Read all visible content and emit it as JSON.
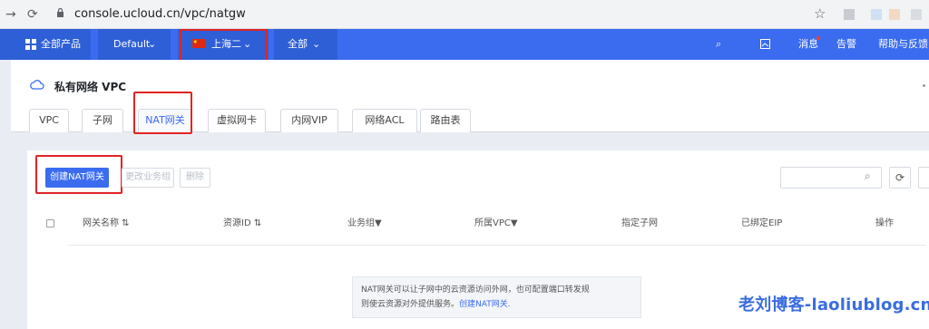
{
  "browser": {
    "url": "console.ucloud.cn/vpc/natgw"
  },
  "topnav": {
    "all_products": "全部产品",
    "project": "Default",
    "region": "上海二",
    "scope": "全部",
    "messages": "消息",
    "alerts": "告警",
    "help": "帮助与反馈"
  },
  "page": {
    "title": "私有网络 VPC",
    "tabs": [
      "VPC",
      "子网",
      "NAT网关",
      "虚拟网卡",
      "内网VIP",
      "网络ACL",
      "路由表"
    ],
    "active_tab": "NAT网关"
  },
  "toolbar": {
    "create": "创建NAT网关",
    "change_group": "更改业务组",
    "delete": "删除",
    "search_placeholder": ""
  },
  "table": {
    "columns": [
      "网关名称",
      "资源ID",
      "业务组",
      "所属VPC",
      "指定子网",
      "已绑定EIP",
      "操作"
    ]
  },
  "empty": {
    "line1": "NAT网关可以让子网中的云资源访问外网，也可配置端口转发规",
    "line2_prefix": "则使云资源对外提供服务。",
    "line2_link": "创建NAT网关."
  },
  "watermark": "老刘博客-laoliublog.cn",
  "colors": {
    "primary": "#3b6cf0",
    "highlight": "#e02424"
  }
}
